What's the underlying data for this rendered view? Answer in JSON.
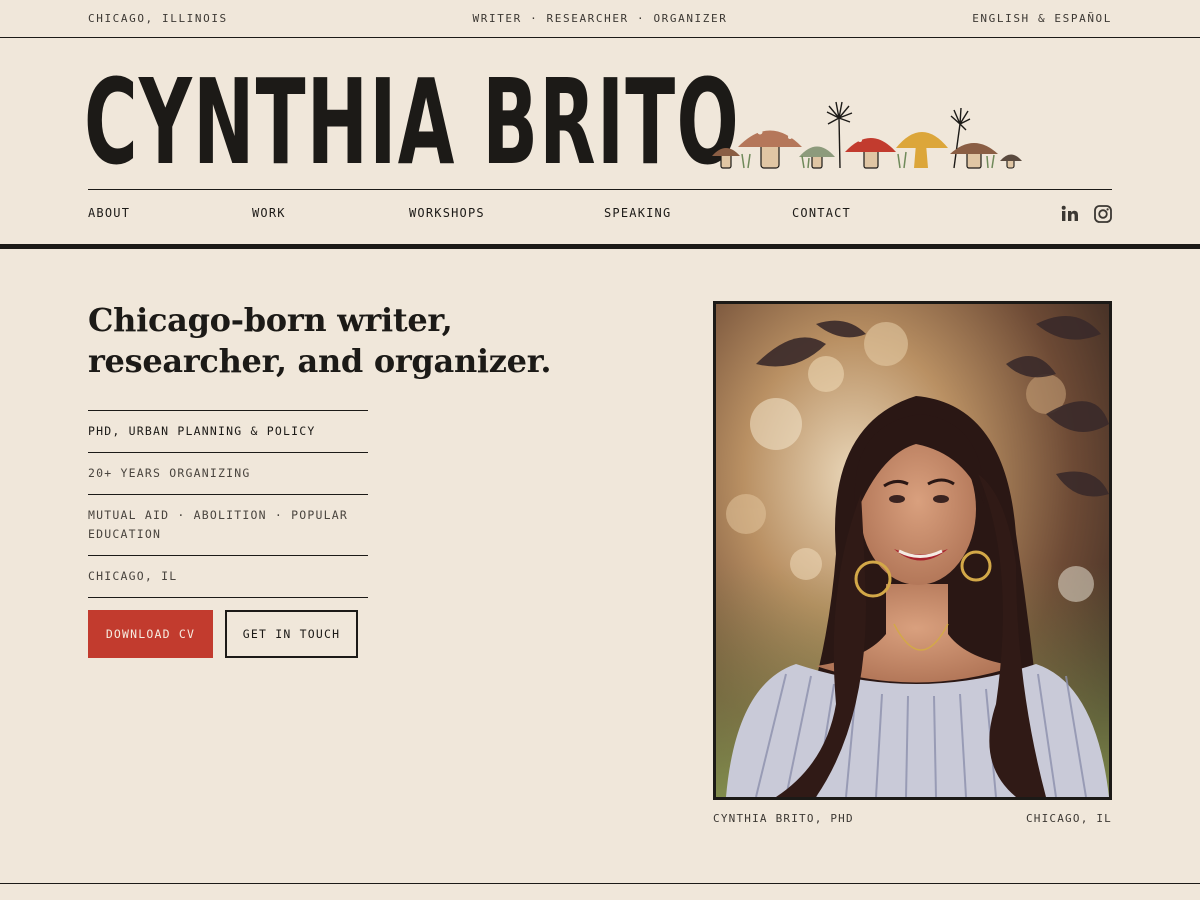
{
  "topbar": {
    "location": "CHICAGO, ILLINOIS",
    "tagline": "WRITER · RESEARCHER · ORGANIZER",
    "language": "ENGLISH & ESPAÑOL"
  },
  "brand": {
    "name": "CYNTHIA BRITO"
  },
  "nav": {
    "items": [
      "ABOUT",
      "WORK",
      "WORKSHOPS",
      "SPEAKING",
      "CONTACT"
    ],
    "social": [
      "linkedin-icon",
      "instagram-icon"
    ]
  },
  "hero": {
    "headline": "Chicago-born writer, researcher, and organizer.",
    "facts": [
      "PHD, URBAN PLANNING & POLICY",
      "20+ YEARS ORGANIZING",
      "MUTUAL AID · ABOLITION · POPULAR EDUCATION",
      "CHICAGO, IL"
    ],
    "cta_primary": "DOWNLOAD CV",
    "cta_secondary": "GET IN TOUCH"
  },
  "portrait": {
    "caption_name": "CYNTHIA BRITO, PHD",
    "caption_place": "CHICAGO, IL"
  },
  "colors": {
    "background": "#f0e7da",
    "ink": "#1c1a17",
    "accent_red": "#c23b2e",
    "mushroom_brown": "#b5775a",
    "mushroom_sage": "#8d9b7c",
    "mushroom_gold": "#dca63a"
  }
}
